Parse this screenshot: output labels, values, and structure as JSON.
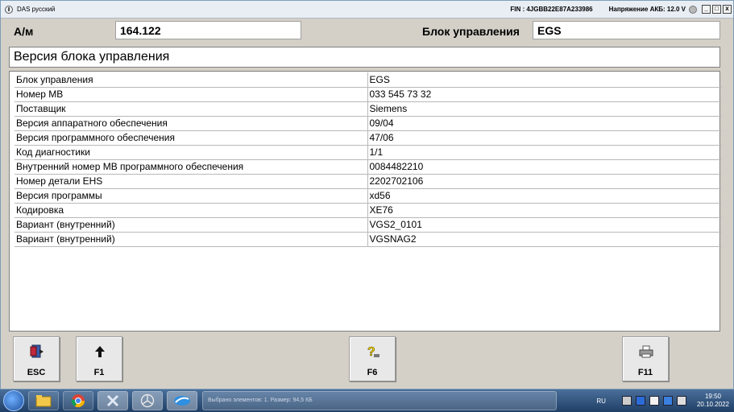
{
  "titlebar": {
    "title": "DAS русский",
    "fin": "FIN : 4JGBB22E87A233986",
    "voltage": "Напряжение АКБ: 12.0 V",
    "min_label": "_",
    "max_label": "□",
    "close_label": "x"
  },
  "header": {
    "label_left": "А/м",
    "value_left": "164.122",
    "label_right": "Блок управления",
    "value_right": "EGS"
  },
  "section_title": "Версия блока управления",
  "table": {
    "rows": [
      {
        "label": "Блок управления",
        "value": "EGS"
      },
      {
        "label": "Номер MB",
        "value": "033 545 73 32"
      },
      {
        "label": "Поставщик",
        "value": "Siemens"
      },
      {
        "label": "Версия аппаратного обеспечения",
        "value": "09/04"
      },
      {
        "label": "Версия программного обеспечения",
        "value": "47/06"
      },
      {
        "label": "Код диагностики",
        "value": "1/1"
      },
      {
        "label": "Внутренний номер MB программного обеспечения",
        "value": "0084482210"
      },
      {
        "label": "Номер детали EHS",
        "value": "2202702106"
      },
      {
        "label": "Версия программы",
        "value": "xd56"
      },
      {
        "label": "Кодировка",
        "value": "XE76"
      },
      {
        "label": "Вариант (внутренний)",
        "value": "VGS2_0101"
      },
      {
        "label": "Вариант (внутренний)",
        "value": "VGSNAG2"
      }
    ]
  },
  "fkeys": {
    "esc": {
      "label": "ESC",
      "icon": "exit-door-icon"
    },
    "f1": {
      "label": "F1",
      "icon": "arrow-up-icon"
    },
    "f6": {
      "label": "F6",
      "icon": "help-question-icon"
    },
    "f11": {
      "label": "F11",
      "icon": "printer-icon"
    }
  },
  "taskbar": {
    "window_title": "Выбрано элементов: 1. Размер: 94,5 КБ",
    "language": "RU",
    "time": "19:50",
    "date": "20.10.2022"
  },
  "colors": {
    "window_bg": "#d4d0c8",
    "taskbar": "#2a4d7a"
  }
}
